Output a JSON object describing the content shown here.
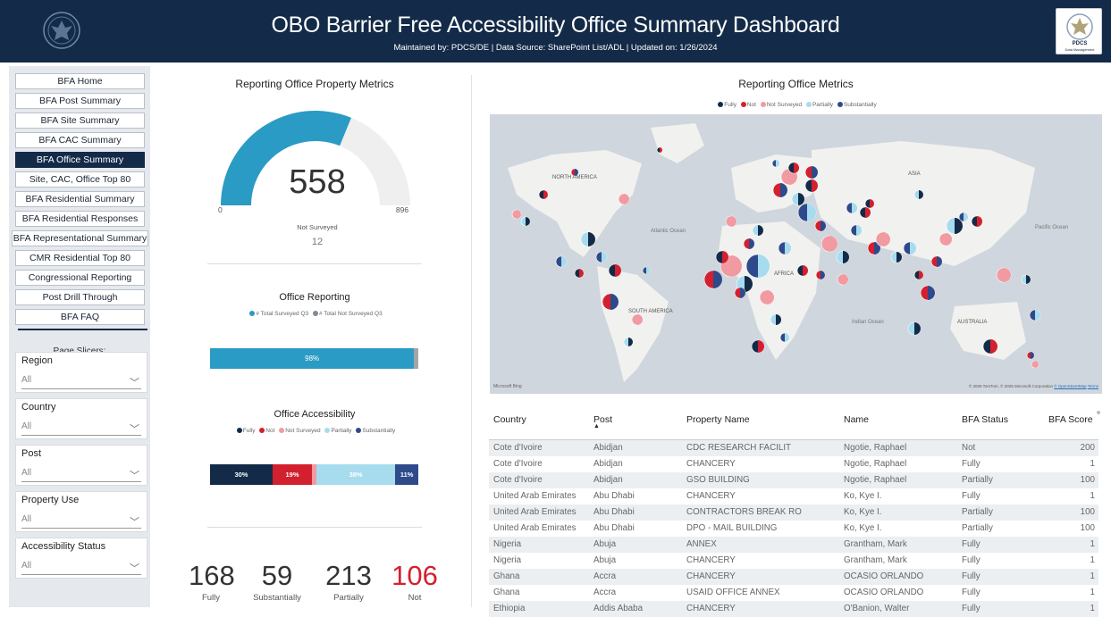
{
  "header": {
    "title": "OBO Barrier Free Accessibility Office Summary Dashboard",
    "subtitle": "Maintained by: PDCS/DE | Data Source: SharePoint List/ADL | Updated on:  1/26/2024",
    "logo_text": "PDCS",
    "logo_subtext": "Data Management"
  },
  "nav": {
    "items": [
      "BFA Home",
      "BFA Post Summary",
      "BFA Site Summary",
      "BFA CAC Summary",
      "BFA Office Summary",
      "Site, CAC, Office Top 80",
      "BFA Residential Summary",
      "BFA Residential Responses",
      "BFA Representational Summary",
      "CMR Residential Top 80",
      "Congressional Reporting",
      "Post Drill Through",
      "BFA FAQ"
    ],
    "active_index": 4,
    "slicers_heading": "Page Slicers:"
  },
  "slicers": [
    {
      "label": "Region",
      "value": "All"
    },
    {
      "label": "Country",
      "value": "All"
    },
    {
      "label": "Post",
      "value": "All"
    },
    {
      "label": "Property Use",
      "value": "All"
    },
    {
      "label": "Accessibility Status",
      "value": "All"
    }
  ],
  "property_metrics": {
    "title": "Reporting Office Property Metrics",
    "gauge_value": "558",
    "gauge_min": "0",
    "gauge_max": "896",
    "gauge_fraction": 0.623,
    "not_surveyed_label": "Not Surveyed",
    "not_surveyed_value": "12"
  },
  "office_reporting": {
    "title": "Office Reporting",
    "legend": [
      "# Total Surveyed Q3",
      "# Total Not Surveyed Q3"
    ],
    "bar_label": "98%",
    "bar_fraction": 0.98
  },
  "office_accessibility": {
    "title": "Office Accessibility",
    "legend": [
      "Fully",
      "Not",
      "Not Surveyed",
      "Partially",
      "Substantially"
    ],
    "segments": [
      {
        "label": "30%",
        "fraction": 0.3
      },
      {
        "label": "19%",
        "fraction": 0.19
      },
      {
        "label": "",
        "fraction": 0.02
      },
      {
        "label": "38%",
        "fraction": 0.38
      },
      {
        "label": "11%",
        "fraction": 0.11
      }
    ]
  },
  "kpis": [
    {
      "value": "168",
      "label": "Fully"
    },
    {
      "value": "59",
      "label": "Substantially"
    },
    {
      "value": "213",
      "label": "Partially"
    },
    {
      "value": "106",
      "label": "Not"
    }
  ],
  "office_metrics": {
    "title": "Reporting Office Metrics",
    "legend": [
      "Fully",
      "Not",
      "Not Surveyed",
      "Partially",
      "Substantially"
    ],
    "map_labels": [
      "NORTH AMERICA",
      "SOUTH AMERICA",
      "AFRICA",
      "ASIA",
      "AUSTRALIA",
      "Atlantic Ocean",
      "Indian Ocean",
      "Pacific Ocean"
    ],
    "map_brand": "Microsoft Bing",
    "map_attribution": "© 2026 TomTom, © 2025 Microsoft Corporation",
    "map_osm": "© OpenStreetMap",
    "map_terms": "Terms"
  },
  "table": {
    "columns": [
      "Country",
      "Post",
      "Property Name",
      "Name",
      "BFA Status",
      "BFA Score"
    ],
    "rows": [
      [
        "Cote d'Ivoire",
        "Abidjan",
        "CDC RESEARCH FACILIT",
        "Ngotie, Raphael",
        "Not",
        "200"
      ],
      [
        "Cote d'Ivoire",
        "Abidjan",
        "CHANCERY",
        "Ngotie, Raphael",
        "Fully",
        "1"
      ],
      [
        "Cote d'Ivoire",
        "Abidjan",
        "GSO BUILDING",
        "Ngotie, Raphael",
        "Partially",
        "100"
      ],
      [
        "United Arab Emirates",
        "Abu Dhabi",
        "CHANCERY",
        "Ko, Kye I.",
        "Fully",
        "1"
      ],
      [
        "United Arab Emirates",
        "Abu Dhabi",
        "CONTRACTORS BREAK RO",
        "Ko, Kye I.",
        "Partially",
        "100"
      ],
      [
        "United Arab Emirates",
        "Abu Dhabi",
        "DPO - MAIL BUILDING",
        "Ko, Kye I.",
        "Partially",
        "100"
      ],
      [
        "Nigeria",
        "Abuja",
        "ANNEX",
        "Grantham, Mark",
        "Fully",
        "1"
      ],
      [
        "Nigeria",
        "Abuja",
        "CHANCERY",
        "Grantham, Mark",
        "Fully",
        "1"
      ],
      [
        "Ghana",
        "Accra",
        "CHANCERY",
        "OCASIO ORLANDO",
        "Fully",
        "1"
      ],
      [
        "Ghana",
        "Accra",
        "USAID OFFICE ANNEX",
        "OCASIO ORLANDO",
        "Fully",
        "1"
      ],
      [
        "Ethiopia",
        "Addis Ababa",
        "CHANCERY",
        "O'Banion, Walter",
        "Fully",
        "1"
      ]
    ]
  },
  "colors": {
    "fully": "#132b48",
    "not": "#d3202f",
    "not_surveyed": "#f29aa2",
    "partially": "#a6dcee",
    "substantially": "#2f4a8a",
    "accent": "#2a9bc4"
  }
}
